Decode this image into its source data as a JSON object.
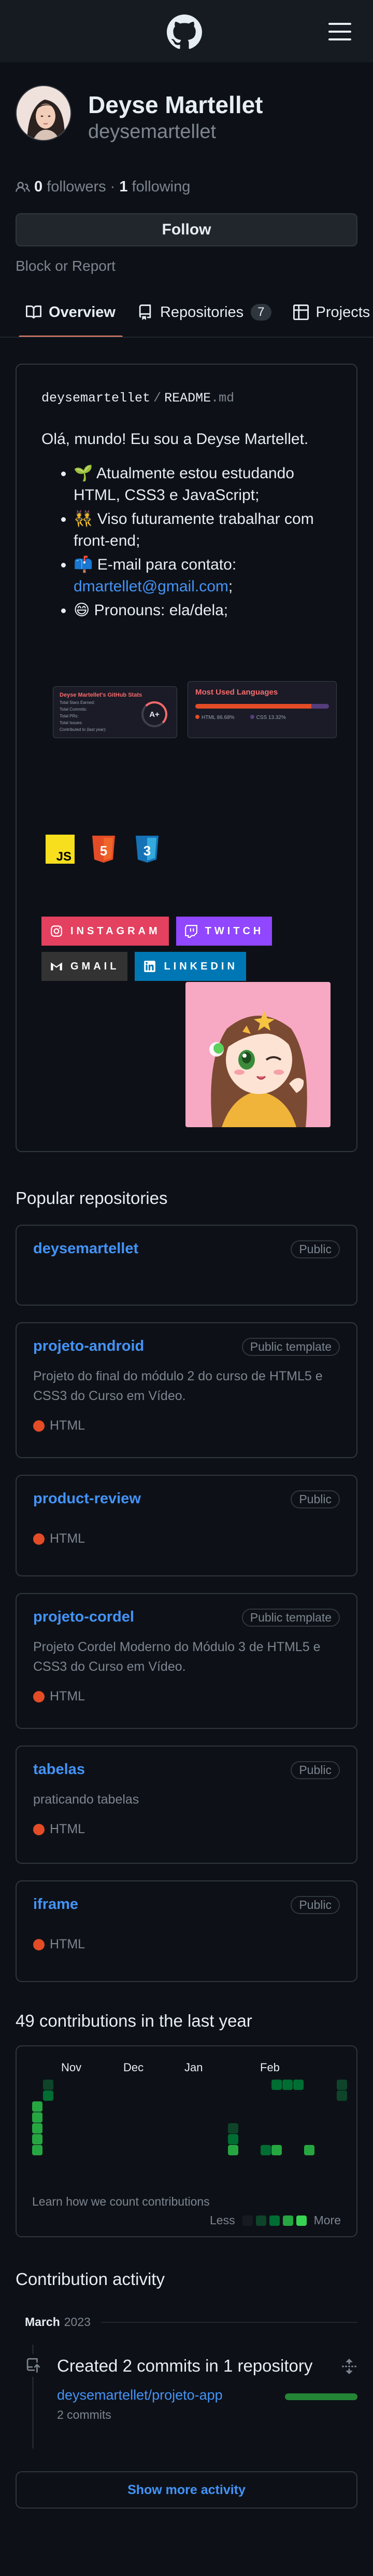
{
  "header": {
    "logo_icon": "github-mark-icon",
    "menu_icon": "hamburger-menu-icon"
  },
  "profile": {
    "display_name": "Deyse Martellet",
    "username": "deysemartellet",
    "followers_count": "0",
    "followers_label": "followers",
    "separator": "·",
    "following_count": "1",
    "following_label": "following",
    "follow_button": "Follow",
    "block_report": "Block or Report"
  },
  "tabs": [
    {
      "label": "Overview",
      "icon": "book-icon",
      "active": true
    },
    {
      "label": "Repositories",
      "icon": "repo-icon",
      "count": "7"
    },
    {
      "label": "Projects",
      "icon": "table-icon"
    }
  ],
  "readme": {
    "path_user": "deysemartellet",
    "path_sep": "/",
    "path_file": "README",
    "path_ext": ".md",
    "intro": "Olá, mundo! Eu sou a Deyse Martellet.",
    "bullets": [
      "🌱 Atualmente estou estudando HTML, CSS3 e JavaScript;",
      "👯 Viso futuramente trabalhar com front-end;",
      "📫 E-mail para contato:",
      "😄 Pronouns: ela/dela;"
    ],
    "email": "dmartellet@gmail.com",
    "email_suffix": ";",
    "stats_card": {
      "title": "Deyse Martellet's GitHub Stats",
      "rows": [
        "Total Stars Earned:",
        "Total Commits:",
        "Total PRs:",
        "Total Issues:",
        "Contributed to (last year):"
      ],
      "grade": "A+"
    },
    "lang_card": {
      "title": "Most Used Languages",
      "languages": [
        {
          "name": "HTML",
          "percent": "86.68%",
          "color": "#e34c26"
        },
        {
          "name": "CSS",
          "percent": "13.32%",
          "color": "#563d7c"
        }
      ]
    },
    "tech_icons": [
      "javascript-icon",
      "html5-icon",
      "css3-icon"
    ],
    "badges": [
      {
        "label": "INSTAGRAM",
        "color": "#e4405f",
        "icon": "instagram-icon"
      },
      {
        "label": "TWITCH",
        "color": "#9146ff",
        "icon": "twitch-icon"
      },
      {
        "label": "GMAIL",
        "color": "#333333",
        "icon": "gmail-icon"
      },
      {
        "label": "LINKEDIN",
        "color": "#0077b5",
        "icon": "linkedin-icon"
      }
    ]
  },
  "popular": {
    "title": "Popular repositories",
    "repos": [
      {
        "name": "deysemartellet",
        "visibility": "Public",
        "description": "",
        "language": ""
      },
      {
        "name": "projeto-android",
        "visibility": "Public template",
        "description": "Projeto do final do módulo 2 do curso de HTML5 e CSS3 do Curso em Vídeo.",
        "language": "HTML"
      },
      {
        "name": "product-review",
        "visibility": "Public",
        "description": "",
        "language": "HTML"
      },
      {
        "name": "projeto-cordel",
        "visibility": "Public template",
        "description": "Projeto Cordel Moderno do Módulo 3 de HTML5 e CSS3 do Curso em Vídeo.",
        "language": "HTML"
      },
      {
        "name": "tabelas",
        "visibility": "Public",
        "description": "praticando tabelas",
        "language": "HTML"
      },
      {
        "name": "iframe",
        "visibility": "Public",
        "description": "",
        "language": "HTML"
      }
    ],
    "language_color": "#e34c26"
  },
  "contributions": {
    "title": "49 contributions in the last year",
    "months": [
      "Nov",
      "Dec",
      "Jan",
      "Feb"
    ],
    "learn": "Learn how we count contributions",
    "less": "Less",
    "more": "More",
    "colors": [
      "#161b22",
      "#0e4429",
      "#006d32",
      "#26a641",
      "#39d353"
    ]
  },
  "activity": {
    "title": "Contribution activity",
    "month": "March",
    "year": "2023",
    "event_title": "Created 2 commits in 1 repository",
    "repo": "deysemartellet/projeto-app",
    "commits": "2 commits",
    "show_more": "Show more activity"
  }
}
